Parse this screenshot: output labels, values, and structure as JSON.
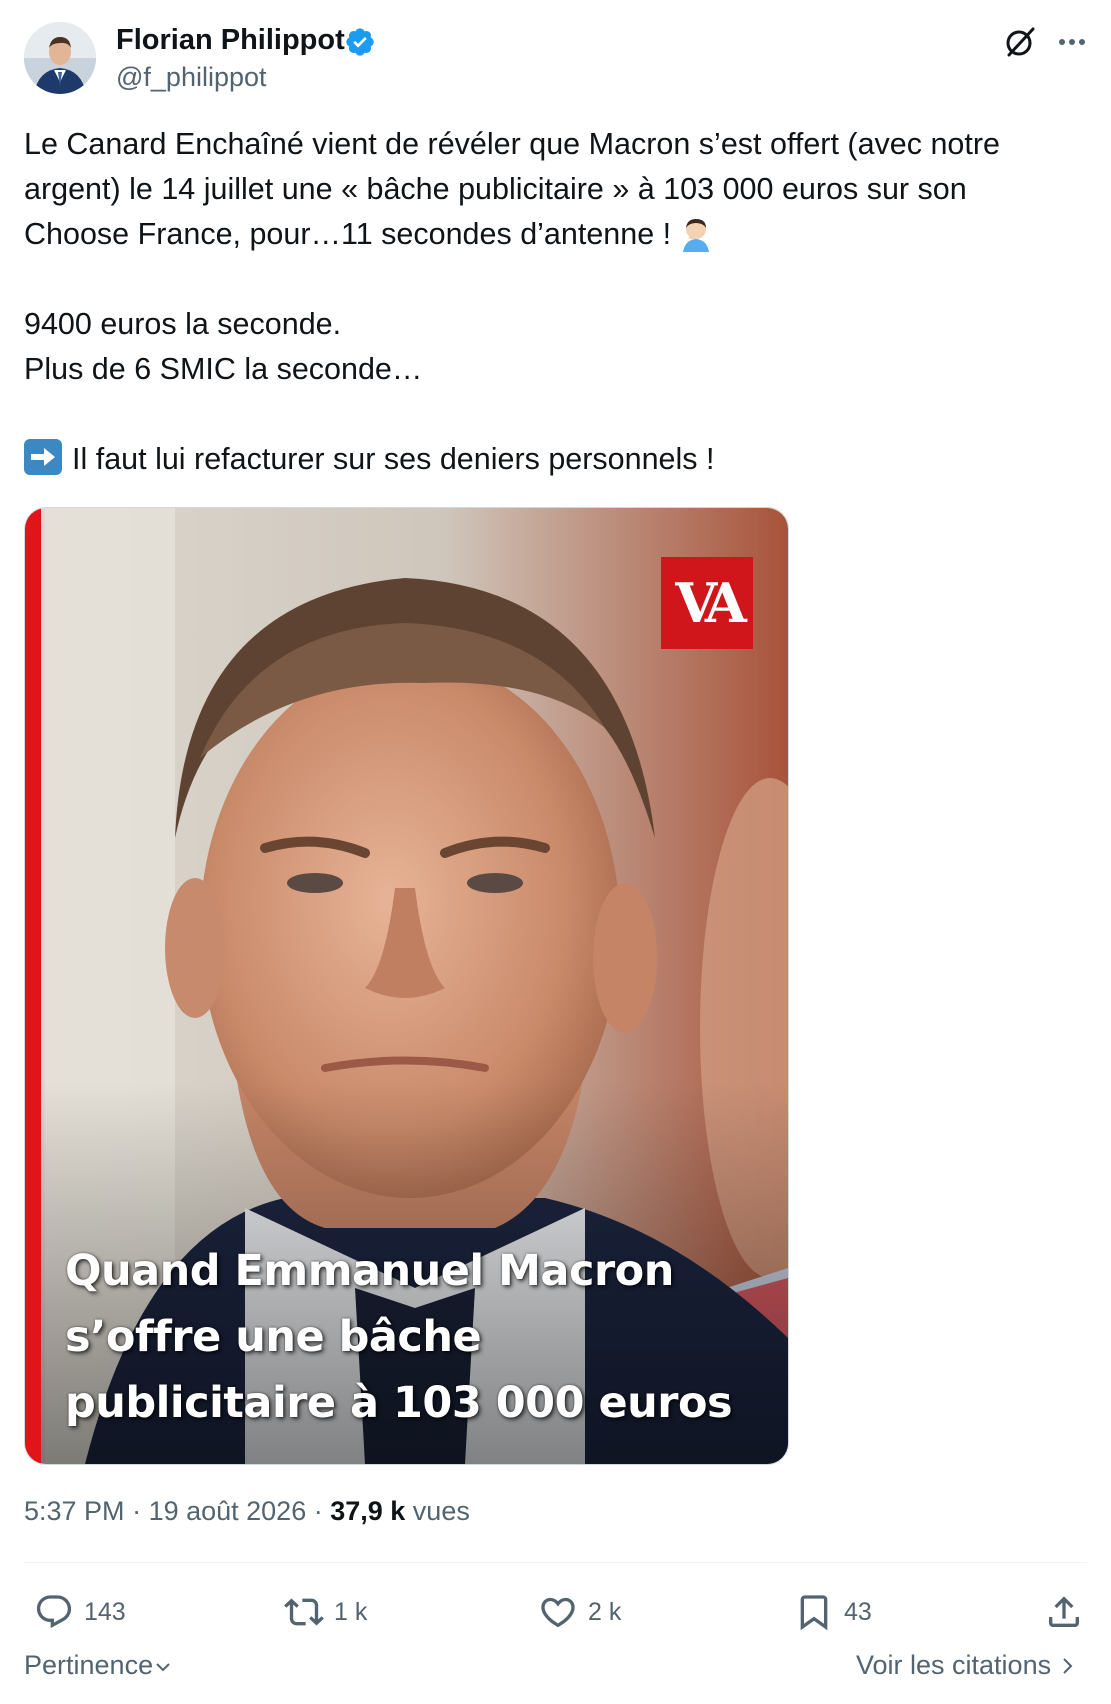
{
  "author": {
    "name": "Florian Philippot",
    "handle": "@f_philippot"
  },
  "tweet": {
    "lines": [
      "Le Canard Enchaîné vient de révéler que Macron s’est offert (avec notre",
      "argent) le 14 juillet une « bâche publicitaire » à 103 000 euros sur son",
      "Choose France, pour…11 secondes d’antenne !"
    ],
    "line4": "9400 euros la seconde.",
    "line5": "Plus de 6 SMIC la seconde…",
    "line6": "Il faut lui refacturer sur ses deniers personnels !"
  },
  "media": {
    "logo_text": "VA",
    "caption": [
      "Quand Emmanuel Macron",
      "s’offre une bâche",
      "publicitaire à 103 000 euros"
    ]
  },
  "meta": {
    "time": "5:37 PM",
    "separator": " · ",
    "date": "19 août 2026",
    "views_count": "37,9 k",
    "views_label": " vues"
  },
  "actions": {
    "replies": "143",
    "reposts": "1 k",
    "likes": "2 k",
    "bookmarks": "43"
  },
  "footer": {
    "sort_label": "Pertinence",
    "quotes_label": "Voir les citations"
  },
  "colors": {
    "text": "#0f1419",
    "secondary": "#536471",
    "verified": "#1d9bf0",
    "logo_red": "#d0151b"
  }
}
